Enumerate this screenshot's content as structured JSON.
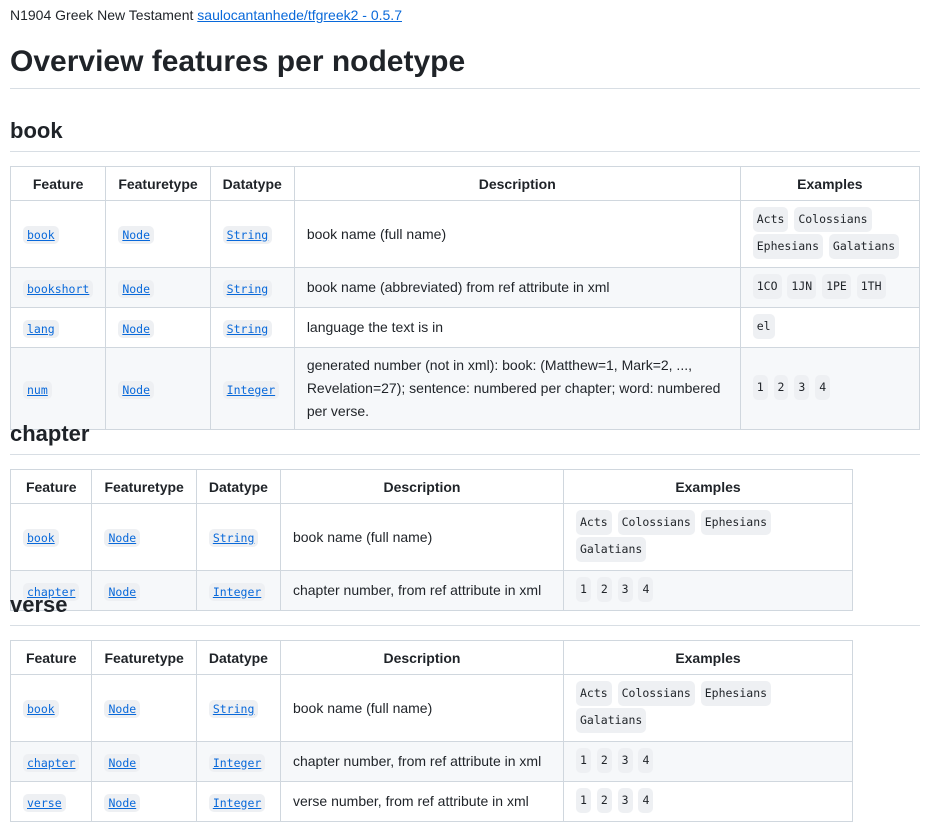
{
  "header": {
    "prefix": "N1904 Greek New Testament",
    "link": "saulocantanhede/tfgreek2 - 0.5.7"
  },
  "title": "Overview features per nodetype",
  "columns": {
    "feature": "Feature",
    "featuretype": "Featuretype",
    "datatype": "Datatype",
    "description": "Description",
    "examples": "Examples"
  },
  "book": {
    "heading": "book",
    "rows": [
      {
        "feature": "book",
        "featuretype": "Node",
        "datatype": "String",
        "description": "book name (full name)",
        "examples": [
          "Acts",
          "Colossians",
          "Ephesians",
          "Galatians"
        ]
      },
      {
        "feature": "bookshort",
        "featuretype": "Node",
        "datatype": "String",
        "description": "book name (abbreviated) from ref attribute in xml",
        "examples": [
          "1CO",
          "1JN",
          "1PE",
          "1TH"
        ]
      },
      {
        "feature": "lang",
        "featuretype": "Node",
        "datatype": "String",
        "description": "language the text is in",
        "examples": [
          "el"
        ]
      },
      {
        "feature": "num",
        "featuretype": "Node",
        "datatype": "Integer",
        "description": "generated number (not in xml): book: (Matthew=1, Mark=2, ..., Revelation=27); sentence: numbered per chapter; word: numbered per verse.",
        "examples": [
          "1",
          "2",
          "3",
          "4"
        ]
      }
    ]
  },
  "chapter": {
    "heading": "chapter",
    "rows": [
      {
        "feature": "book",
        "featuretype": "Node",
        "datatype": "String",
        "description": "book name (full name)",
        "examples": [
          "Acts",
          "Colossians",
          "Ephesians",
          "Galatians"
        ]
      },
      {
        "feature": "chapter",
        "featuretype": "Node",
        "datatype": "Integer",
        "description": "chapter number, from ref attribute in xml",
        "examples": [
          "1",
          "2",
          "3",
          "4"
        ]
      }
    ]
  },
  "verse": {
    "heading": "verse",
    "rows": [
      {
        "feature": "book",
        "featuretype": "Node",
        "datatype": "String",
        "description": "book name (full name)",
        "examples": [
          "Acts",
          "Colossians",
          "Ephesians",
          "Galatians"
        ]
      },
      {
        "feature": "chapter",
        "featuretype": "Node",
        "datatype": "Integer",
        "description": "chapter number, from ref attribute in xml",
        "examples": [
          "1",
          "2",
          "3",
          "4"
        ]
      },
      {
        "feature": "verse",
        "featuretype": "Node",
        "datatype": "Integer",
        "description": "verse number, from ref attribute in xml",
        "examples": [
          "1",
          "2",
          "3",
          "4"
        ]
      }
    ]
  }
}
